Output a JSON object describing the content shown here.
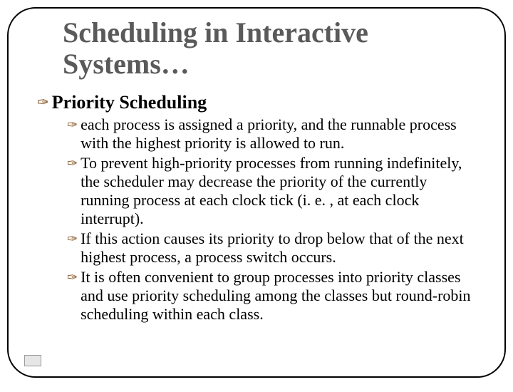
{
  "title": "Scheduling in Interactive Systems…",
  "section": {
    "heading": "Priority Scheduling",
    "items": [
      "each process is assigned a priority, and the runnable process with the highest priority is allowed to run.",
      "To prevent high-priority processes from running indefinitely, the scheduler may decrease the priority of the currently running process at each clock tick (i. e. , at each clock interrupt).",
      "If this action causes its priority to drop below that of the next highest process, a process switch occurs.",
      "It is often convenient to group processes into priority classes and use priority scheduling among the classes but round-robin scheduling within each class."
    ]
  },
  "glyphs": {
    "bullet": "✑"
  }
}
